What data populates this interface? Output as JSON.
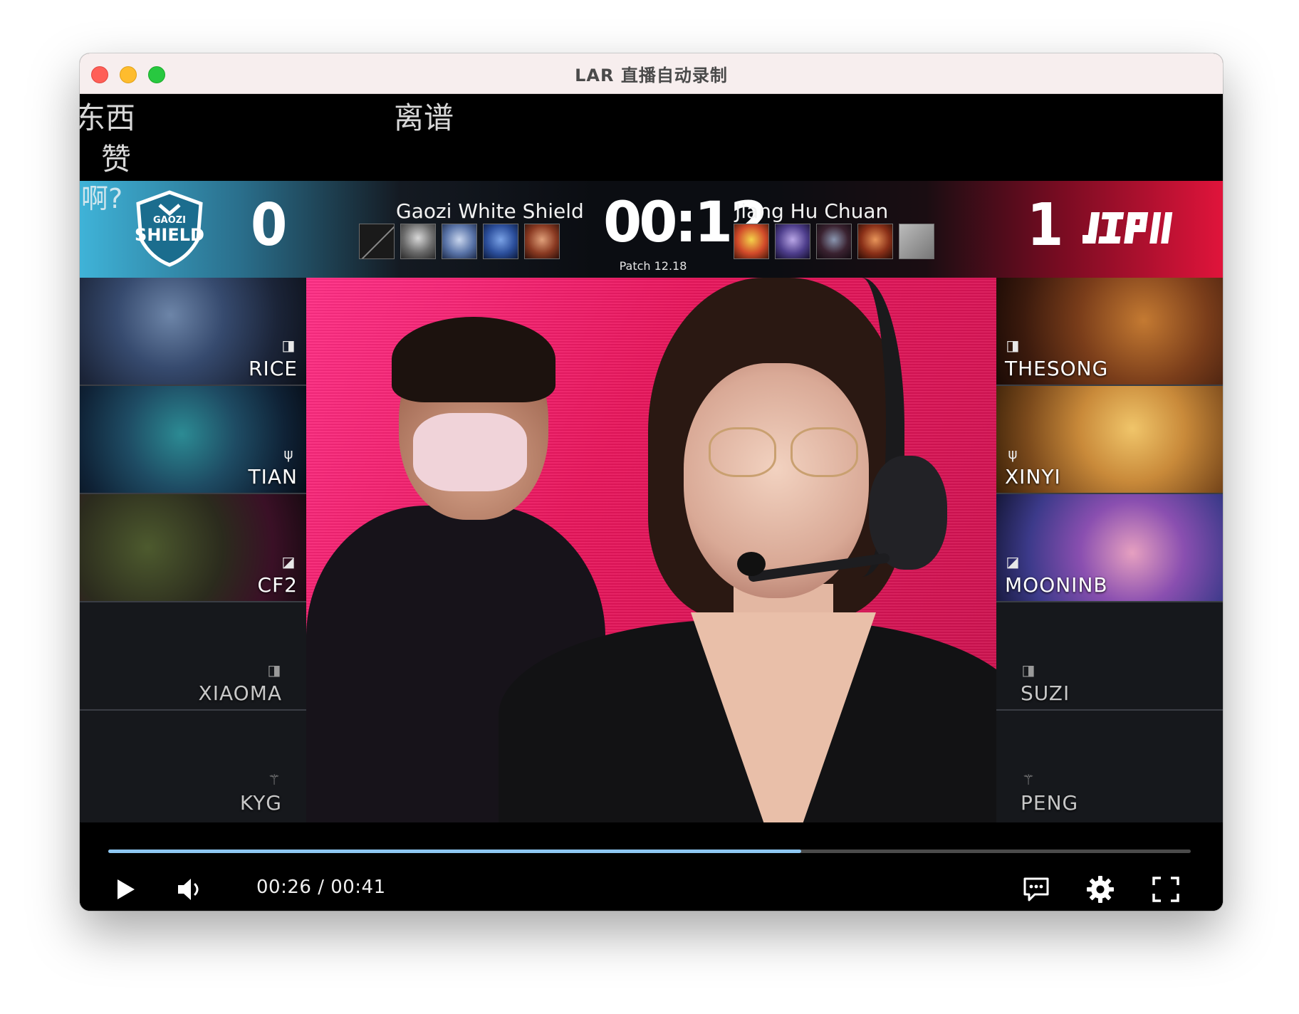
{
  "window": {
    "title": "LAR 直播自动录制"
  },
  "danmaku": [
    {
      "text": "东西"
    },
    {
      "text": "离谱"
    },
    {
      "text": "赞"
    },
    {
      "text": "啊?"
    }
  ],
  "scoreboard": {
    "left_team": {
      "name": "Gaozi White Shield",
      "logo_text": "GAOZI SHIELD",
      "score": "0"
    },
    "right_team": {
      "name": "Jiang Hu Chuan",
      "logo_text": "JDG",
      "score": "1"
    },
    "timer": "00:12",
    "patch": "Patch 12.18"
  },
  "players": {
    "left": [
      {
        "name": "RICE",
        "role": "top-icon"
      },
      {
        "name": "TIAN",
        "role": "jungle-icon"
      },
      {
        "name": "CF2",
        "role": "mid-icon"
      },
      {
        "name": "XIAOMA",
        "role": "top-icon"
      },
      {
        "name": "KYG",
        "role": "support-icon"
      }
    ],
    "right": [
      {
        "name": "THESONG",
        "role": "top-icon"
      },
      {
        "name": "XINYI",
        "role": "jungle-icon"
      },
      {
        "name": "MOONINB",
        "role": "mid-icon"
      },
      {
        "name": "SUZI",
        "role": "top-icon"
      },
      {
        "name": "PENG",
        "role": "support-icon"
      }
    ]
  },
  "player_controls": {
    "time_display": "00:26 / 00:41",
    "progress_fraction": 0.64,
    "play_icon": "play-icon",
    "volume_icon": "volume-icon",
    "danmaku_icon": "comment-icon",
    "settings_icon": "gear-icon",
    "fullscreen_icon": "fullscreen-icon"
  },
  "colors": {
    "left_team_accent": "#3fb3d8",
    "right_team_accent": "#e0143b",
    "progress_fill": "#8ec7f2",
    "stage_bg": "#e8145a"
  }
}
